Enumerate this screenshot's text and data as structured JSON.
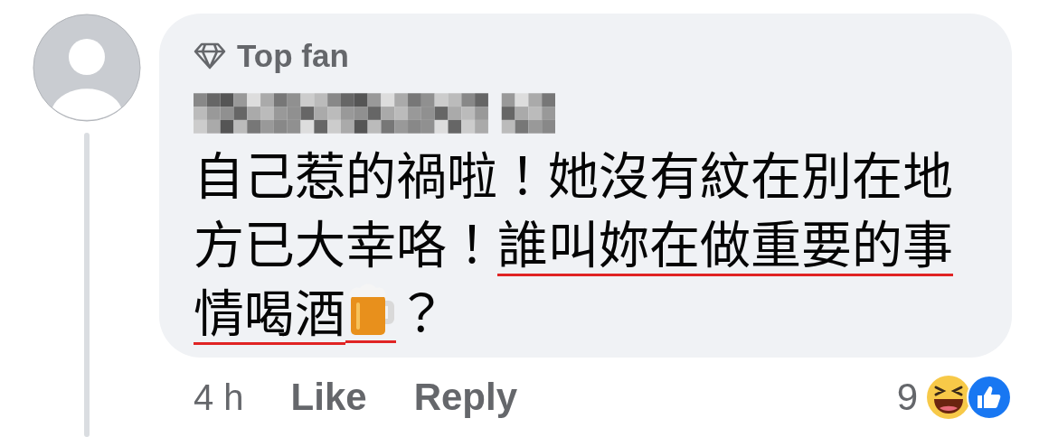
{
  "comment": {
    "badge": "Top fan",
    "lines": [
      [
        {
          "kind": "text",
          "text": "自己惹的禍啦！她沒有紋在別在地",
          "underlined": false
        }
      ],
      [
        {
          "kind": "text",
          "text": "方已大幸咯！",
          "underlined": false
        },
        {
          "kind": "text",
          "text": "誰叫妳在做重要的事",
          "underlined": true
        }
      ],
      [
        {
          "kind": "text",
          "text": "情喝酒",
          "underlined": true
        },
        {
          "kind": "beer",
          "underlined": true
        },
        {
          "kind": "text",
          "text": "？",
          "underlined": false
        }
      ]
    ]
  },
  "footer": {
    "time": "4 h",
    "actions": [
      "Like",
      "Reply"
    ],
    "reaction_count": "9"
  }
}
